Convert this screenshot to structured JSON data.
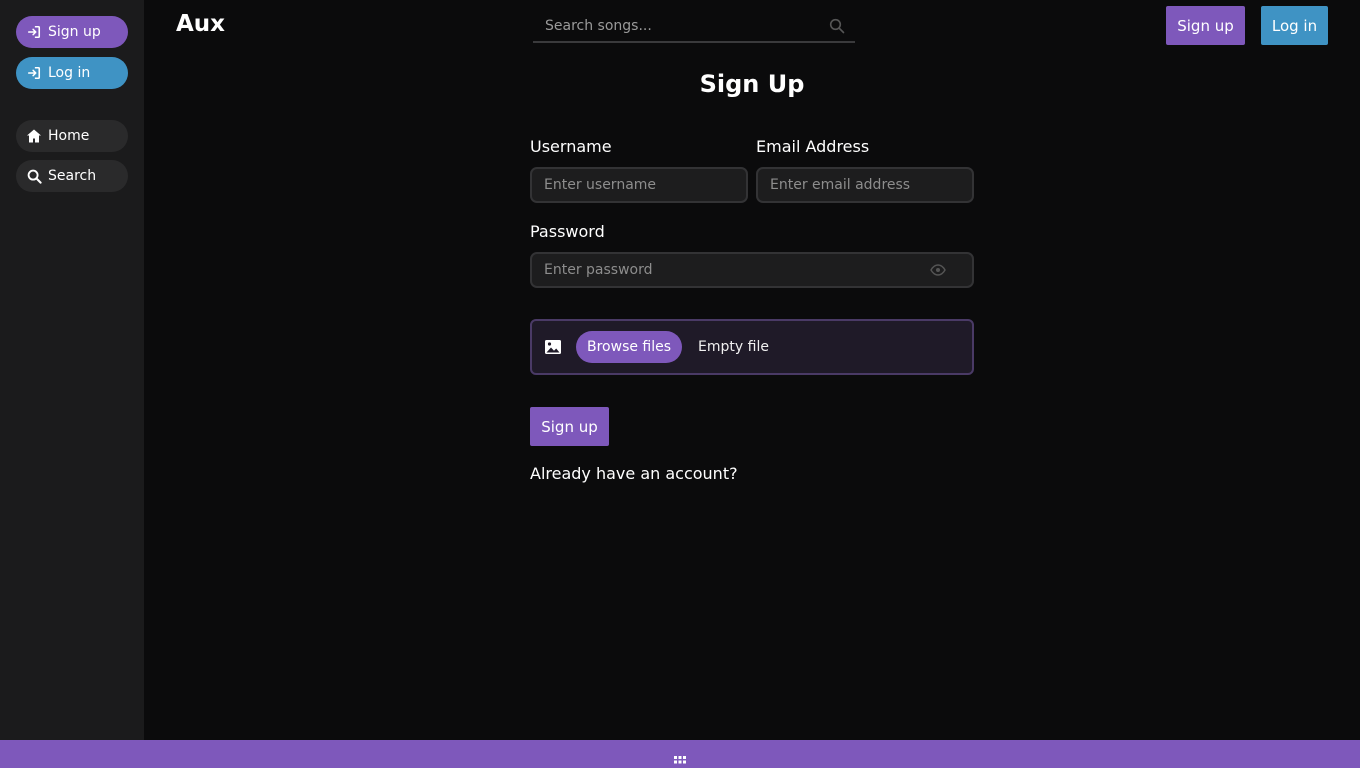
{
  "sidebar": {
    "signup_label": "Sign up",
    "login_label": "Log in",
    "nav": [
      {
        "label": "Home",
        "icon": "home-icon"
      },
      {
        "label": "Search",
        "icon": "search-icon"
      }
    ]
  },
  "header": {
    "brand": "Aux",
    "search_placeholder": "Search songs...",
    "signup_label": "Sign up",
    "login_label": "Log in"
  },
  "form": {
    "title": "Sign Up",
    "username_label": "Username",
    "username_placeholder": "Enter username",
    "email_label": "Email Address",
    "email_placeholder": "Enter email address",
    "password_label": "Password",
    "password_placeholder": "Enter password",
    "browse_label": "Browse files",
    "file_status": "Empty file",
    "submit_label": "Sign up",
    "already_label": "Already have an account?"
  },
  "colors": {
    "accent_purple": "#7e58bb",
    "accent_blue": "#3f93c4",
    "background": "#0b0b0c",
    "sidebar": "#1b1b1c"
  }
}
